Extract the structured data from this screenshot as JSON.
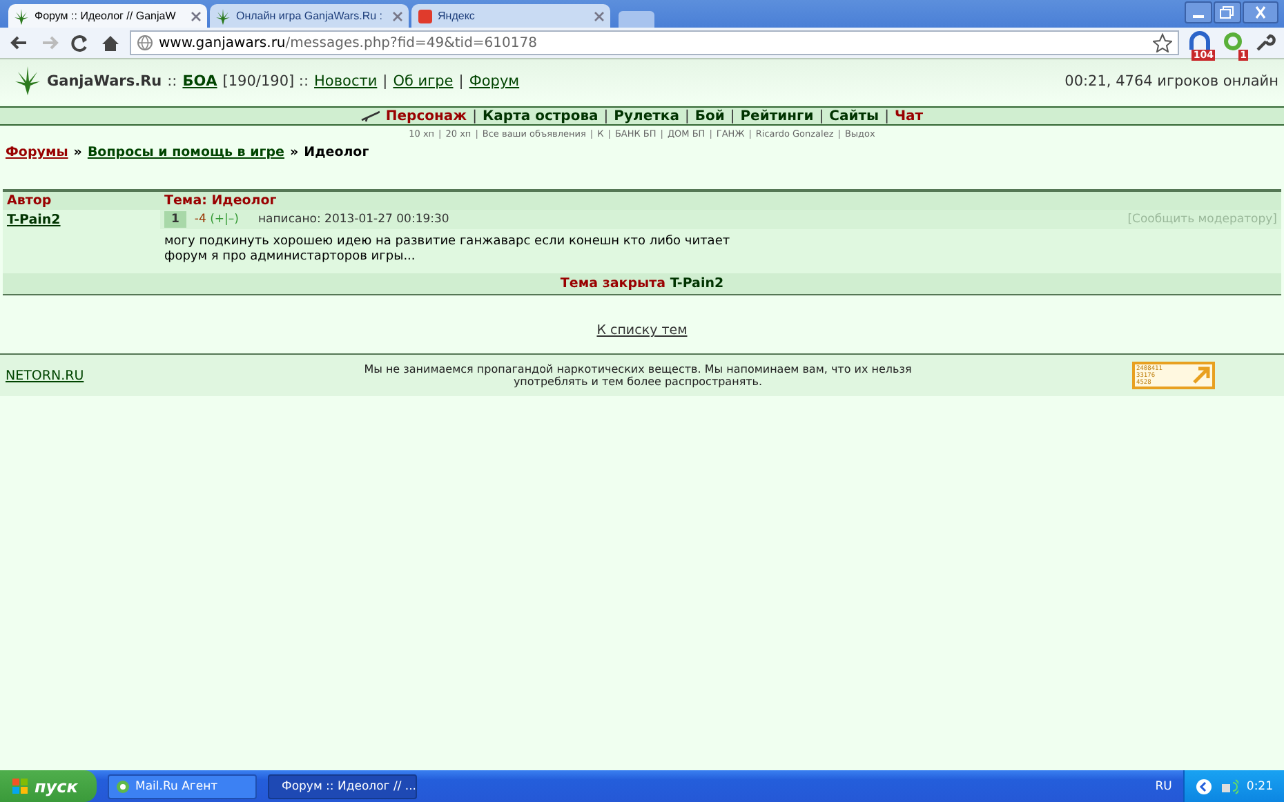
{
  "browser": {
    "tabs": [
      {
        "title": "Форум :: Идеолог // GanjaW",
        "selected": true
      },
      {
        "title": "Онлайн игра GanjaWars.Ru :",
        "selected": false
      },
      {
        "title": "Яндекс",
        "selected": false
      }
    ],
    "address": {
      "host": "www.ganjawars.ru",
      "path": "/messages.php?fid=49&tid=610178"
    },
    "badges": [
      "104",
      "1"
    ]
  },
  "header": {
    "items": [
      {
        "text": "GanjaWars.Ru",
        "kind": "brand"
      },
      {
        "text": "::",
        "kind": "text"
      },
      {
        "text": "БОА",
        "kind": "strong-link"
      },
      {
        "text": "[190/190] ::",
        "kind": "text"
      },
      {
        "text": "Новости",
        "kind": "link"
      },
      {
        "text": "|",
        "kind": "text"
      },
      {
        "text": "Об игре",
        "kind": "link"
      },
      {
        "text": "|",
        "kind": "text"
      },
      {
        "text": "Форум",
        "kind": "link"
      }
    ],
    "online": "00:21, 4764 игроков онлайн"
  },
  "nav": {
    "separator": "|",
    "items": [
      {
        "label": "Персонаж",
        "highlight": true
      },
      {
        "label": "Карта острова",
        "highlight": false
      },
      {
        "label": "Рулетка",
        "highlight": false
      },
      {
        "label": "Бой",
        "highlight": false
      },
      {
        "label": "Рейтинги",
        "highlight": false
      },
      {
        "label": "Сайты",
        "highlight": false
      },
      {
        "label": "Чат",
        "highlight": true
      }
    ]
  },
  "subnav": {
    "separator": "|",
    "items": [
      "10 хп",
      "20 хп",
      "Все ваши объявления",
      "К",
      "БАНК БП",
      "ДОМ БП",
      "ГАНЖ",
      "Ricardo Gonzalez",
      "Выдох"
    ]
  },
  "breadcrumb": {
    "separator": "»",
    "items": [
      "Форумы",
      "Вопросы и помощь в игре",
      "Идеолог"
    ]
  },
  "topic": {
    "columns": [
      "Автор",
      "Тема: Идеолог"
    ],
    "post": {
      "author": "T-Pain2",
      "number": "1",
      "rating": "-4",
      "vote": "(+|–)",
      "date": "написано: 2013-01-27 00:19:30",
      "report": "[Сообщить модератору]",
      "lines": [
        "могу подкинуть хорошею идею на развитие ганжаварс если конешн кто либо читает",
        "форум я про администарторов игры..."
      ]
    },
    "closed": {
      "label": "Тема закрыта",
      "by": "T-Pain2"
    }
  },
  "back_link": "К списку тем",
  "footer": {
    "site": "NETORN.RU",
    "notice": "Мы не занимаемся пропагандой наркотических веществ. Мы напоминаем вам, что их нельзя употреблять и тем более распространять.",
    "counter": [
      "2408411",
      "33176",
      "4528"
    ]
  },
  "taskbar": {
    "start": "пуск",
    "tasks": [
      {
        "label": "Mail.Ru Агент",
        "selected": false
      },
      {
        "label": "Форум :: Идеолог // ...",
        "selected": true
      }
    ],
    "lang": "RU",
    "time": "0:21"
  }
}
